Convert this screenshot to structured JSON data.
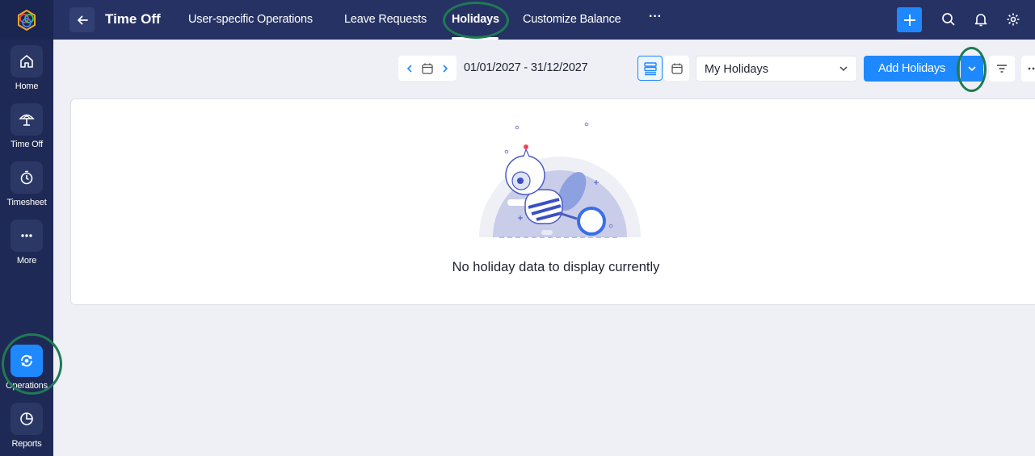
{
  "app": {
    "module_title": "Time Off"
  },
  "rail": {
    "items": [
      {
        "label": "Home",
        "icon": "home-icon"
      },
      {
        "label": "Time Off",
        "icon": "umbrella-icon"
      },
      {
        "label": "Timesheet",
        "icon": "timer-icon"
      },
      {
        "label": "More",
        "icon": "more-dots-icon"
      },
      {
        "label": "Operations",
        "icon": "operations-icon"
      },
      {
        "label": "Reports",
        "icon": "pie-chart-icon"
      }
    ]
  },
  "topbar": {
    "tabs": [
      {
        "label": "User-specific Operations"
      },
      {
        "label": "Leave Requests"
      },
      {
        "label": "Holidays",
        "active": true
      },
      {
        "label": "Customize Balance"
      }
    ],
    "more_label": "···"
  },
  "toolbar": {
    "date_range": "01/01/2027 - 31/12/2027",
    "filter_select": "My Holidays",
    "add_button": "Add Holidays"
  },
  "content": {
    "empty_message": "No holiday data to display currently"
  },
  "colors": {
    "accent": "#1e88ff",
    "rail_bg": "#1e2a55",
    "topbar_bg": "#263264",
    "annotation": "#1f7a55"
  }
}
